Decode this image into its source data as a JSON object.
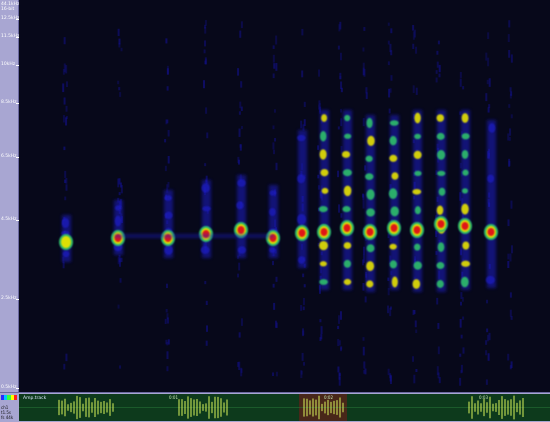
{
  "frequency_axis": {
    "header": [
      "44.1kHz",
      "16-bit"
    ],
    "ticks": [
      {
        "label": "12.5kHz"
      },
      {
        "label": "11.5kHz"
      },
      {
        "label": "10kHz"
      },
      {
        "label": "8.5kHz"
      },
      {
        "label": "6.5kHz"
      },
      {
        "label": "4.5kHz"
      },
      {
        "label": "2.5kHz"
      },
      {
        "label": "0.5kHz"
      }
    ]
  },
  "overview": {
    "tag": "Amp.track",
    "info": [
      "ch1",
      "t1.5s",
      "fs 44k"
    ],
    "ruler": [
      "0:00",
      "0:01",
      "0:02",
      "0:03",
      "0:04"
    ],
    "swatch_colors": [
      "#2a2aff",
      "#00c8ff",
      "#3cff3c",
      "#ffff00",
      "#ff2020"
    ]
  },
  "palette": {
    "spectrogram_bg": "#07081a",
    "energy_low": "#1d1ac2",
    "energy_mid": "#2fbf6a",
    "energy_high": "#e6e200",
    "energy_peak": "#e01212",
    "waveform": "#d8f25a",
    "selection": "#7a1818"
  }
}
